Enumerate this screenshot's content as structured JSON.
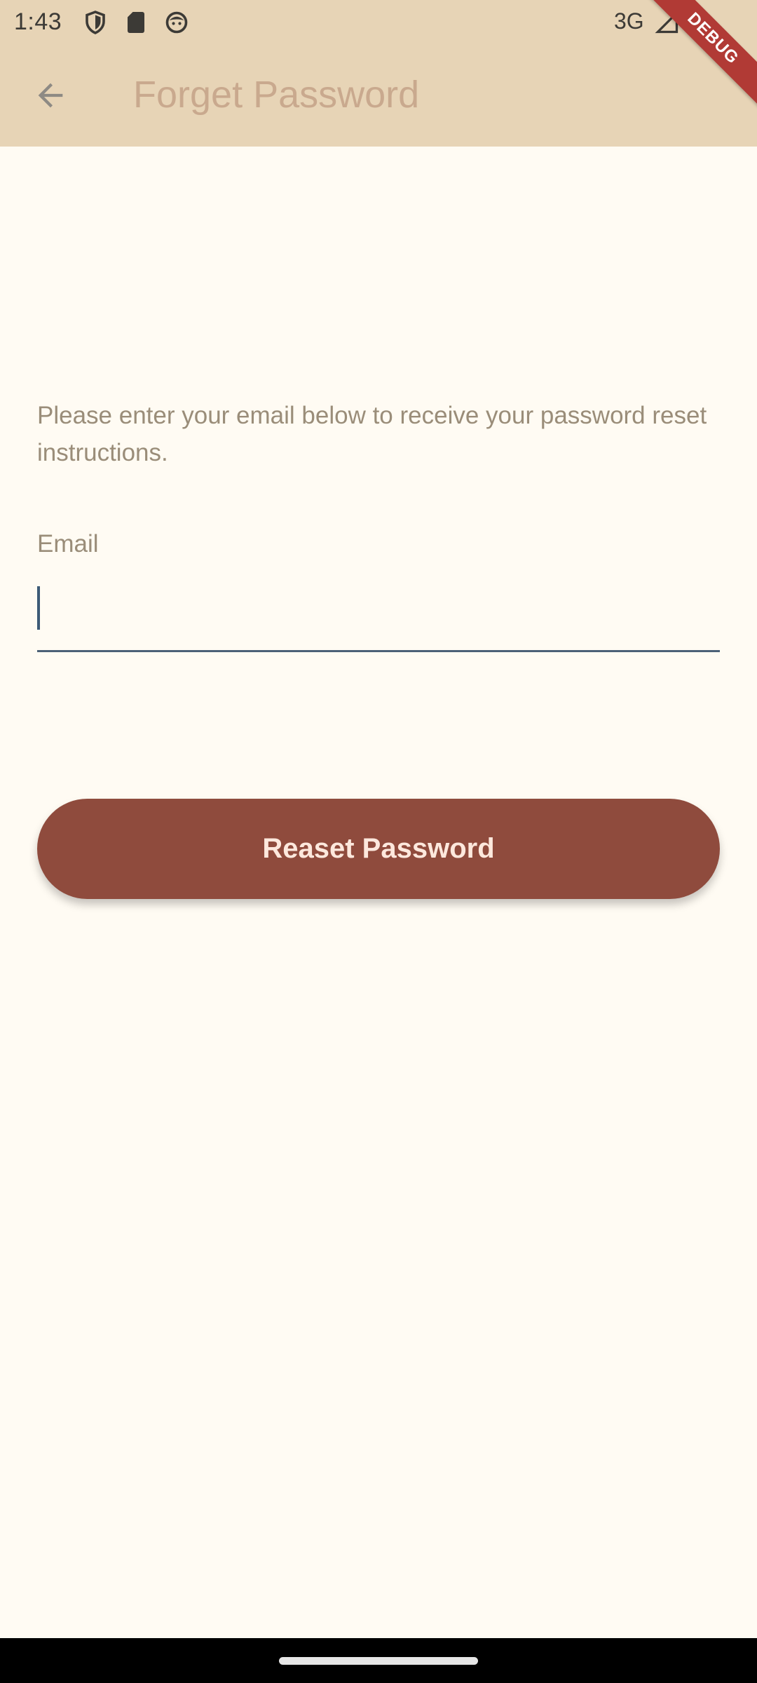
{
  "status_bar": {
    "time": "1:43",
    "network": "3G",
    "icons": [
      "shield-icon",
      "sd-card-icon",
      "face-icon",
      "signal-icon",
      "battery-icon"
    ]
  },
  "app_bar": {
    "title": "Forget Password",
    "back_icon": "arrow-back-icon",
    "debug_label": "DEBUG"
  },
  "form": {
    "instructions": "Please enter your email below to receive your password reset instructions.",
    "email_label": "Email",
    "email_value": "",
    "submit_label": "Reaset Password"
  },
  "colors": {
    "app_bar_bg": "#e7d4b6",
    "page_bg": "#fffbf3",
    "button_bg": "#8f4b3d",
    "button_text": "#fde8dd",
    "field_underline": "#4c6177"
  }
}
